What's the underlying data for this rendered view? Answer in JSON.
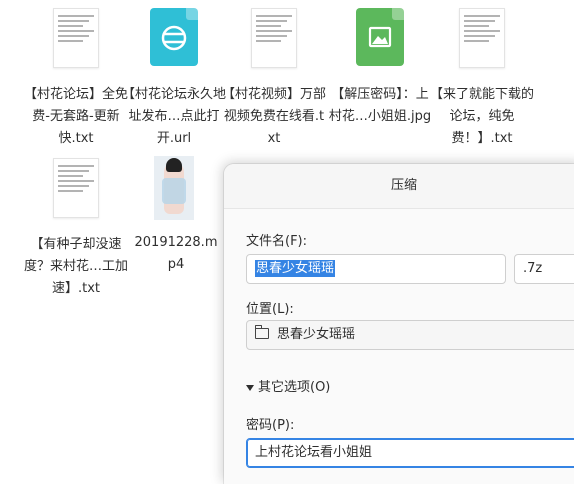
{
  "files": [
    {
      "name": "【村花论坛】全免费-无套路-更新快.txt",
      "type": "doc"
    },
    {
      "name": "【村花论坛永久地址发布…点此打开.url",
      "type": "url"
    },
    {
      "name": "【村花视频】万部视频免费在线看.txt",
      "type": "doc"
    },
    {
      "name": "【解压密码】：上村花…小姐姐.jpg",
      "type": "image"
    },
    {
      "name": "【来了就能下载的论坛，纯免费！】.txt",
      "type": "doc"
    },
    {
      "name": "【有种子却没速度？来村花…工加速】.txt",
      "type": "doc"
    },
    {
      "name": "20191228.mp4",
      "type": "video"
    }
  ],
  "dialog": {
    "title": "压缩",
    "filename_label": "文件名(F):",
    "filename_value": "思春少女瑶瑶",
    "extension": ".7z",
    "location_label": "位置(L):",
    "location_value": "思春少女瑶瑶",
    "more_options": "其它选项(O)",
    "password_label": "密码(P):",
    "password_value": "上村花论坛看小姐姐"
  },
  "colors": {
    "url_icon": "#2fbfd6",
    "image_icon": "#5cb85c",
    "selection": "#3584e4"
  }
}
